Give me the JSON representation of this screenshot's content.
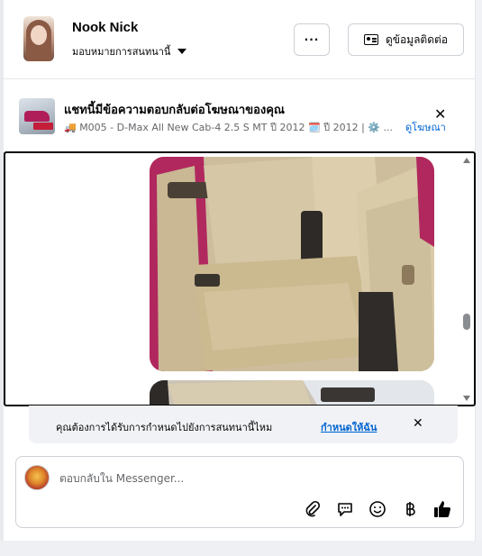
{
  "header": {
    "contact_name": "Nook Nick",
    "assign_label": "มอบหมายการสนทนานี้",
    "more_label": "···",
    "contact_button_label": "ดูข้อมูลติดต่อ"
  },
  "ad": {
    "title": "แชทนี้มีข้อความตอบกลับต่อโฆษณาของคุณ",
    "subtitle": "🚚 M005 - D-Max All New Cab-4 2.5 S MT ปี 2012 🗓️ ปี 2012 | ⚙️ ...",
    "view_ad_label": "ดูโฆษณา",
    "close_label": "✕"
  },
  "reminder": {
    "text": "คุณต้องการได้รับการกำหนดไปยังการสนทนานี้ไหม",
    "link_label": "กำหนดให้ฉัน",
    "close_label": "✕"
  },
  "composer": {
    "placeholder": "ตอบกลับใน Messenger...",
    "tools": [
      "paperclip-icon",
      "saved-reply-icon",
      "emoji-icon",
      "baht-icon",
      "thumbs-up-icon"
    ]
  },
  "colors": {
    "accent": "#0064d1",
    "border": "#ccd0d5",
    "muted": "#65676b"
  }
}
